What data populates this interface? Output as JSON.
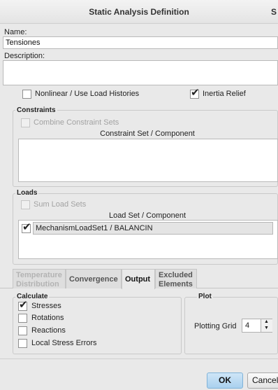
{
  "window": {
    "title": "Static Analysis Definition",
    "title_trunc": "S"
  },
  "name": {
    "label": "Name:",
    "value": "Tensiones"
  },
  "description": {
    "label": "Description:",
    "value": ""
  },
  "options": {
    "nonlinear": {
      "label": "Nonlinear / Use Load Histories",
      "checked": false
    },
    "inertia": {
      "label": "Inertia Relief",
      "checked": true
    }
  },
  "constraints": {
    "legend": "Constraints",
    "combine_label": "Combine Constraint Sets",
    "column_header": "Constraint Set / Component",
    "rows": []
  },
  "loads": {
    "legend": "Loads",
    "sum_label": "Sum Load Sets",
    "column_header": "Load Set / Component",
    "rows": [
      {
        "checked": true,
        "label": "MechanismLoadSet1 / BALANCIN"
      }
    ]
  },
  "tabs": [
    {
      "line1": "Temperature",
      "line2": "Distribution",
      "state": "disabled"
    },
    {
      "line1": "Convergence",
      "line2": "",
      "state": "normal"
    },
    {
      "line1": "Output",
      "line2": "",
      "state": "active"
    },
    {
      "line1": "Excluded",
      "line2": "Elements",
      "state": "normal"
    }
  ],
  "calculate": {
    "legend": "Calculate",
    "items": [
      {
        "label": "Stresses",
        "checked": true
      },
      {
        "label": "Rotations",
        "checked": false
      },
      {
        "label": "Reactions",
        "checked": false
      },
      {
        "label": "Local Stress Errors",
        "checked": false
      }
    ]
  },
  "plot": {
    "legend": "Plot",
    "grid_label": "Plotting Grid",
    "grid_value": "4"
  },
  "buttons": {
    "ok": "OK",
    "cancel": "Cancel"
  },
  "colors": {
    "primary_button": "#a9d1ee",
    "background": "#e9e9e9"
  }
}
